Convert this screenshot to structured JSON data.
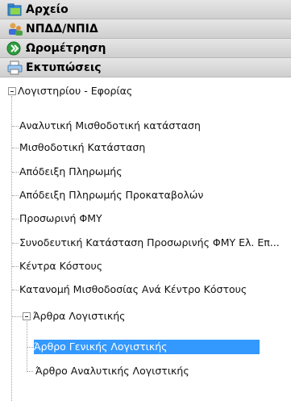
{
  "menu": [
    {
      "label": "Αρχείο",
      "icon": "folder-icon"
    },
    {
      "label": "ΝΠΔΔ/ΝΠΙΔ",
      "icon": "users-icon"
    },
    {
      "label": "Ωρομέτρηση",
      "icon": "next-arrow-icon"
    },
    {
      "label": "Εκτυπώσεις",
      "icon": "printer-icon"
    }
  ],
  "tree": {
    "root": "Λογιστηρίου - Εφορίας",
    "items": [
      "Αναλυτική Μισθοδοτική κατάσταση",
      "Μισθοδοτική Κατάσταση",
      "Απόδειξη Πληρωμής",
      "Απόδειξη Πληρωμής Προκαταβολών",
      "Προσωρινή ΦΜΥ",
      "Συνοδευτική Κατάσταση Προσωρινής ΦΜΥ Ελ. Επ...",
      "Κέντρα Κόστους",
      "Κατανομή Μισθοδοσίας Ανά Κέντρο Κόστους"
    ],
    "subfolder": "Άρθρα Λογιστικής",
    "subitems": [
      "Άρθρο Γενικής Λογιστικής",
      "Άρθρο Αναλυτικής Λογιστικής"
    ],
    "selected": "Άρθρο Γενικής Λογιστικής"
  },
  "colors": {
    "selection": "#3399ff",
    "header": "#d9d9d9"
  }
}
